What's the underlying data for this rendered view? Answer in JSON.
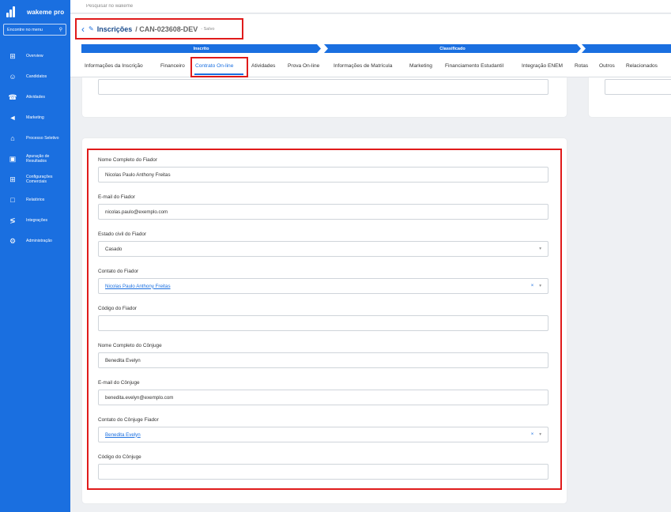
{
  "brand": {
    "name": "wakeme pro"
  },
  "sidebar": {
    "search_label": "Encontre no menu",
    "items": [
      {
        "label": "Overview",
        "icon": "grid-icon"
      },
      {
        "label": "Candidatos",
        "icon": "users-icon"
      },
      {
        "label": "Atividades",
        "icon": "phone-icon"
      },
      {
        "label": "Marketing",
        "icon": "megaphone-icon"
      },
      {
        "label": "Processo Seletivo",
        "icon": "graduation-cap-icon"
      },
      {
        "label": "Apuração de Resultados",
        "icon": "document-icon"
      },
      {
        "label": "Configurações Comerciais",
        "icon": "grid-icon"
      },
      {
        "label": "Relatórios",
        "icon": "report-icon"
      },
      {
        "label": "Integrações",
        "icon": "share-icon"
      },
      {
        "label": "Administração",
        "icon": "gear-icon"
      }
    ]
  },
  "topbar": {
    "search_placeholder": "Pesquisar no wakeme"
  },
  "header": {
    "title": "Inscrições",
    "record_id": "/ CAN-023608-DEV",
    "status": "- Salvo",
    "stages": [
      "Inscrito",
      "Classificado",
      ""
    ],
    "tabs": [
      "Informações da Inscrição",
      "Financeiro",
      "Contrato On-line",
      "Atividades",
      "Prova On-line",
      "Informações de Matrícula",
      "Marketing",
      "Financiamento Estudantil",
      "Integração ENEM",
      "Rotas",
      "Outros",
      "Relacionados"
    ],
    "active_tab": "Contrato On-line"
  },
  "form": {
    "fields": [
      {
        "label": "Nome Completo do Fiador",
        "value": "Nicolas Paulo Anthony Freitas",
        "type": "text"
      },
      {
        "label": "E-mail do Fiador",
        "value": "nicolas.paulo@exemplo.com",
        "type": "text"
      },
      {
        "label": "Estado civil do Fiador",
        "value": "Casado",
        "type": "select"
      },
      {
        "label": "Contato do Fiador",
        "value": "Nicolas Paulo Anthony Freitas",
        "type": "lookup"
      },
      {
        "label": "Código do Fiador",
        "value": "",
        "type": "text"
      },
      {
        "label": "Nome Completo do Cônjuge",
        "value": "Benedita Evelyn",
        "type": "text"
      },
      {
        "label": "E-mail do Cônjuge",
        "value": "benedita.evelyn@exemplo.com",
        "type": "text"
      },
      {
        "label": "Contato do Cônjuge Fiador",
        "value": "Benedita Evelyn",
        "type": "lookup"
      },
      {
        "label": "Código do Cônjuge",
        "value": "",
        "type": "text"
      }
    ]
  },
  "colors": {
    "primary": "#1a6fe0",
    "highlight": "#e01b1b"
  }
}
